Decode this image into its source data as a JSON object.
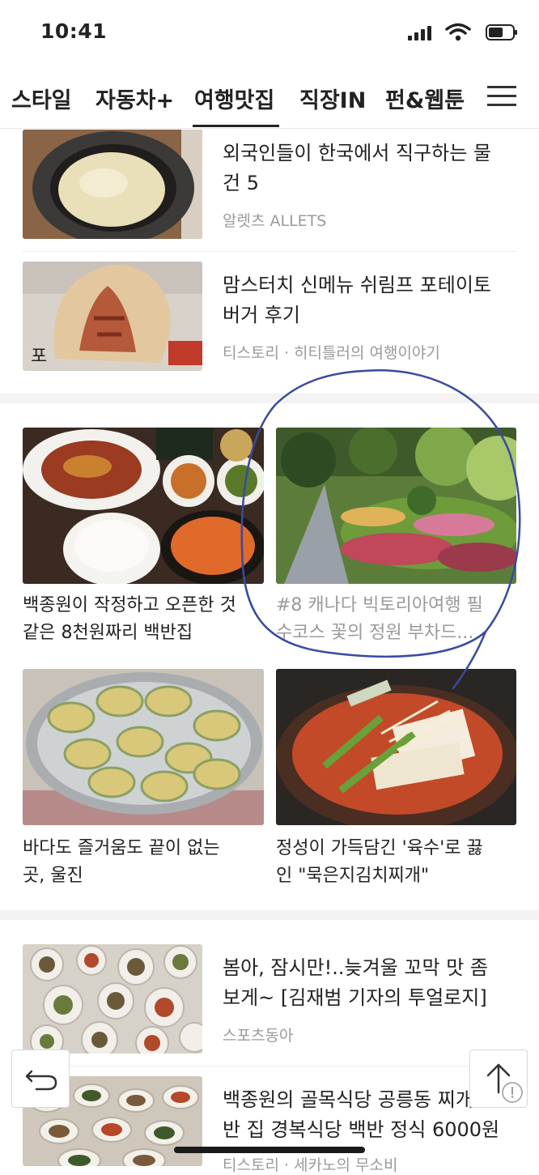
{
  "status": {
    "time": "10:41"
  },
  "tabs": [
    {
      "label": "스타일"
    },
    {
      "label": "자동차+"
    },
    {
      "label": "여행맛집"
    },
    {
      "label": "직장IN"
    },
    {
      "label": "펀&웹툰"
    }
  ],
  "active_tab": "여행맛집",
  "list_top": [
    {
      "title_l1": "외국인들이 한국에서 직구하는 물",
      "title_l2": "건 5",
      "source": "알렛츠 ALLETS"
    },
    {
      "title_l1": "맘스터치 신메뉴 쉬림프 포테이토",
      "title_l2": "버거 후기",
      "source": "티스토리 · 히티틀러의 여행이야기"
    }
  ],
  "grid": [
    {
      "title_l1": "백종원이 작정하고 오픈한 것",
      "title_l2": "같은 8천원짜리 백반집"
    },
    {
      "title_l1": "#8 캐나다 빅토리아여행 필",
      "title_l2": "수코스 꽃의 정원 부차드..."
    },
    {
      "title_l1": "바다도 즐거움도 끝이 없는",
      "title_l2": "곳, 울진"
    },
    {
      "title_l1": "정성이 가득담긴 '육수'로 끓",
      "title_l2": "인 \"묵은지김치찌개\""
    }
  ],
  "list_bottom": [
    {
      "title_l1": "봄아, 잠시만!..늦겨울 꼬막 맛 좀",
      "title_l2": "보게~ [김재범 기자의 투얼로지]",
      "source": "스포츠동아"
    },
    {
      "title_l1": "백종원의 골목식당 공릉동 찌개",
      "title_l2": "반 집 경복식당 백반 정식 6000원",
      "source": "티스토리 · 세카노의 무소비"
    }
  ],
  "colors": {
    "annotation": "#3a4aa0",
    "muted": "#9a9a9a",
    "text": "#222222"
  }
}
